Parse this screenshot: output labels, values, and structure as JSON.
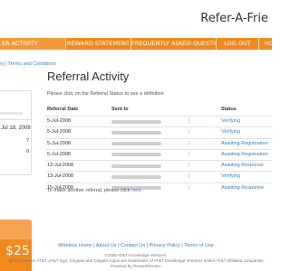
{
  "header": {
    "logo_text": "Refer-A-Frie"
  },
  "nav": {
    "tabs": [
      {
        "label": "ER ACTIVITY",
        "active": true
      },
      {
        "label": "REWARD STATEMENT"
      },
      {
        "label": "FREQUENTLY ASKED QUESTIONS"
      },
      {
        "label": "LOG OUT"
      },
      {
        "label": "HOME"
      }
    ]
  },
  "subnav": {
    "text": "ry | Terms and Conditions"
  },
  "sidebar": {
    "date": "Jul 18, 2008",
    "count1": "7",
    "count2": "0",
    "card_amount": "$25"
  },
  "main": {
    "title": "Referral Activity",
    "instruction": "Please click on the Referral Status to see a definition",
    "columns": {
      "date": "Referral Date",
      "sent": "Sent to",
      "status": "Status"
    },
    "rows": [
      {
        "date": "5-Jul-2008",
        "status": "Verifying"
      },
      {
        "date": "5-Jul-2008",
        "status": "Verifying"
      },
      {
        "date": "5-Jul-2008",
        "status": "Awaiting Registration"
      },
      {
        "date": "5-Jul-2008",
        "status": "Awaiting Registration"
      },
      {
        "date": "13-Jul-2008",
        "status": "Awaiting Response"
      },
      {
        "date": "13-Jul-2008",
        "status": "Verifying"
      },
      {
        "date": "15-Jul-2008",
        "status": "Awaiting Response"
      }
    ],
    "another_prefix": "To make another referral, please click",
    "another_link": "here."
  },
  "footer": {
    "links": [
      "Wireless Home",
      "About Us",
      "Contact Us",
      "Privacy Policy",
      "Terms of Use"
    ],
    "copy1": "©2008 AT&T Knowledge Ventures.",
    "copy2": "rights reserved. AT&T, AT&T logo, Cingular and Cingular logos are trademarks of AT&T Knowledge Ventures and/or AT&T affiliated companies.",
    "copy3": "Powered by RewardStream."
  },
  "colors": {
    "accent": "#f08a1e",
    "link": "#3c7fc0"
  }
}
